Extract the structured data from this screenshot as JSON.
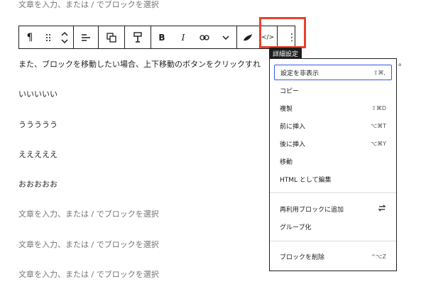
{
  "blocks": {
    "top_placeholder": "文章を入力、または / でブロックを選択",
    "paragraph_main": "また、ブロックを移動したい場合、上下移動のボタンをクリックすれ",
    "paragraph_main_end": "。",
    "line_i": "いいいいい",
    "line_u": "ううううう",
    "line_e": "えええええ",
    "line_o": "おおおおお",
    "placeholders": [
      "文章を入力、または / でブロックを選択",
      "文章を入力、または / でブロックを選択",
      "文章を入力、または / でブロックを選択"
    ]
  },
  "toolbar": {
    "paragraph_glyph": "¶",
    "bold": "B",
    "italic": "I",
    "code": "</>",
    "more": "⋮"
  },
  "tooltip": "詳細設定",
  "menu": {
    "items_group1": [
      {
        "label": "設定を非表示",
        "shortcut": "⇧⌘,"
      },
      {
        "label": "コピー",
        "shortcut": ""
      },
      {
        "label": "複製",
        "shortcut": "⇧⌘D"
      },
      {
        "label": "前に挿入",
        "shortcut": "⌥⌘T"
      },
      {
        "label": "後に挿入",
        "shortcut": "⌥⌘Y"
      },
      {
        "label": "移動",
        "shortcut": ""
      },
      {
        "label": "HTML として編集",
        "shortcut": ""
      }
    ],
    "items_group2": [
      {
        "label": "再利用ブロックに追加",
        "shortcut": ""
      },
      {
        "label": "グループ化",
        "shortcut": ""
      }
    ],
    "items_group3": [
      {
        "label": "ブロックを削除",
        "shortcut": "^⌥Z"
      }
    ]
  },
  "colors": {
    "highlight": "#e8412e",
    "focus": "#3858e9"
  }
}
